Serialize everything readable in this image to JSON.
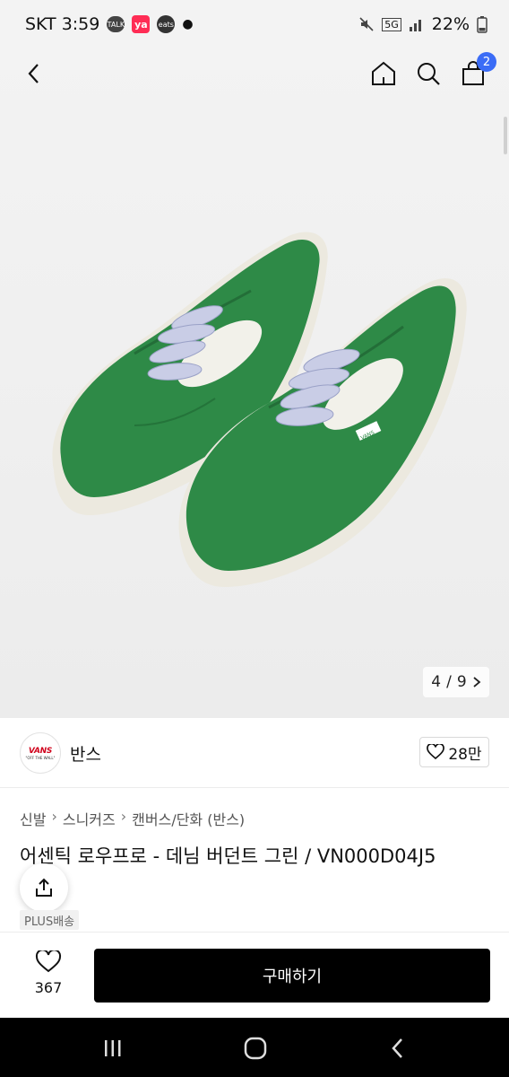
{
  "status_bar": {
    "carrier_time": "SKT 3:59",
    "talk_label": "TALK",
    "ya_label": "ya",
    "eats_label": "eats",
    "network": "5G",
    "battery": "22%"
  },
  "product": {
    "image_counter": {
      "current": "4",
      "separator": "/",
      "total": "9"
    },
    "brand": {
      "name": "반스",
      "logo_text": "VANS",
      "logo_tagline": "\"OFF THE WALL\"",
      "like_count": "28만"
    },
    "breadcrumb": [
      "신발",
      "스니커즈",
      "캔버스/단화 (반스)"
    ],
    "title": "어센틱 로우프로 - 데님 버던트 그린 / VN000D04J5",
    "badge": "PLUS배송",
    "shoe_tag": "VANS"
  },
  "nav": {
    "cart_count": "2"
  },
  "bottom": {
    "wish_count": "367",
    "buy_label": "구매하기"
  },
  "colors": {
    "shoe_green": "#2e8a47",
    "cta": "#000000",
    "badge_blue": "#3b6cf6",
    "brand_red": "#d0021b"
  }
}
